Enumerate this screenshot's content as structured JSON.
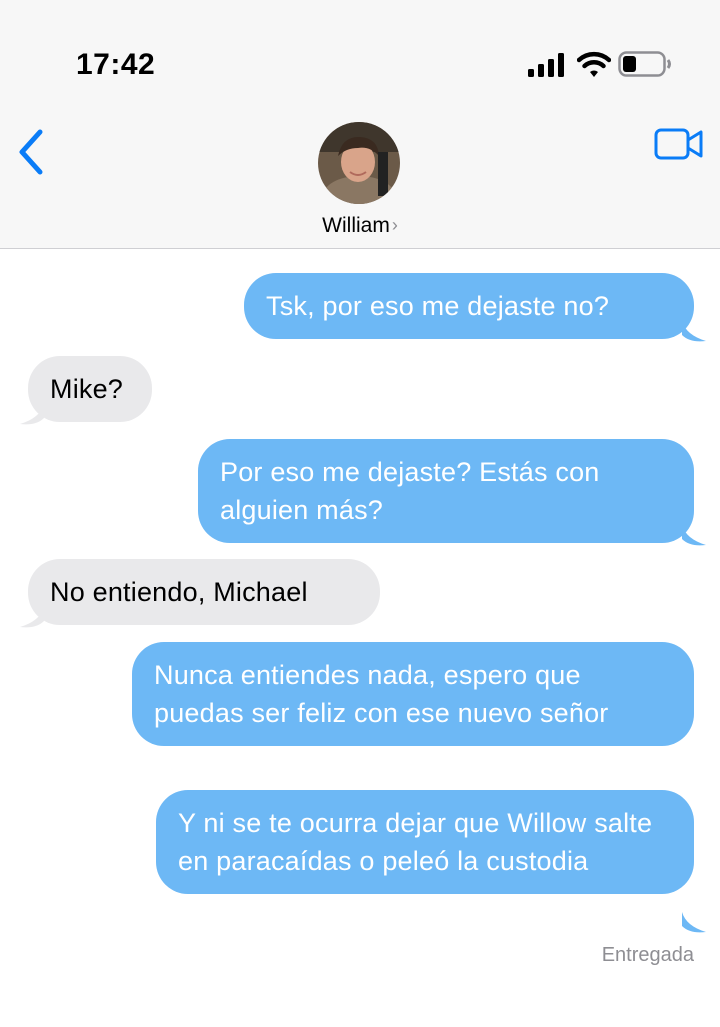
{
  "status_bar": {
    "time": "17:42"
  },
  "header": {
    "contact_name": "William",
    "chevron": "›"
  },
  "colors": {
    "accent": "#0a7cf7",
    "sent_bubble": "#6db8f5",
    "received_bubble": "#e9e9eb"
  },
  "icons": [
    "cellular-signal-icon",
    "wifi-icon",
    "battery-icon",
    "back-chevron-icon",
    "video-call-icon"
  ],
  "messages": [
    {
      "direction": "sent",
      "text": "Tsk, por eso me dejaste no?"
    },
    {
      "direction": "received",
      "text": "Mike?"
    },
    {
      "direction": "sent",
      "text": "Por eso me dejaste? Estás con alguien más?"
    },
    {
      "direction": "received",
      "text": "No entiendo, Michael"
    },
    {
      "direction": "sent",
      "text": "Nunca entiendes nada, espero que puedas ser feliz con ese nuevo señor"
    },
    {
      "direction": "sent",
      "text": "Y ni se te ocurra dejar que Willow salte en paracaídas o peleó la custodia"
    }
  ],
  "delivery_status": "Entregada"
}
